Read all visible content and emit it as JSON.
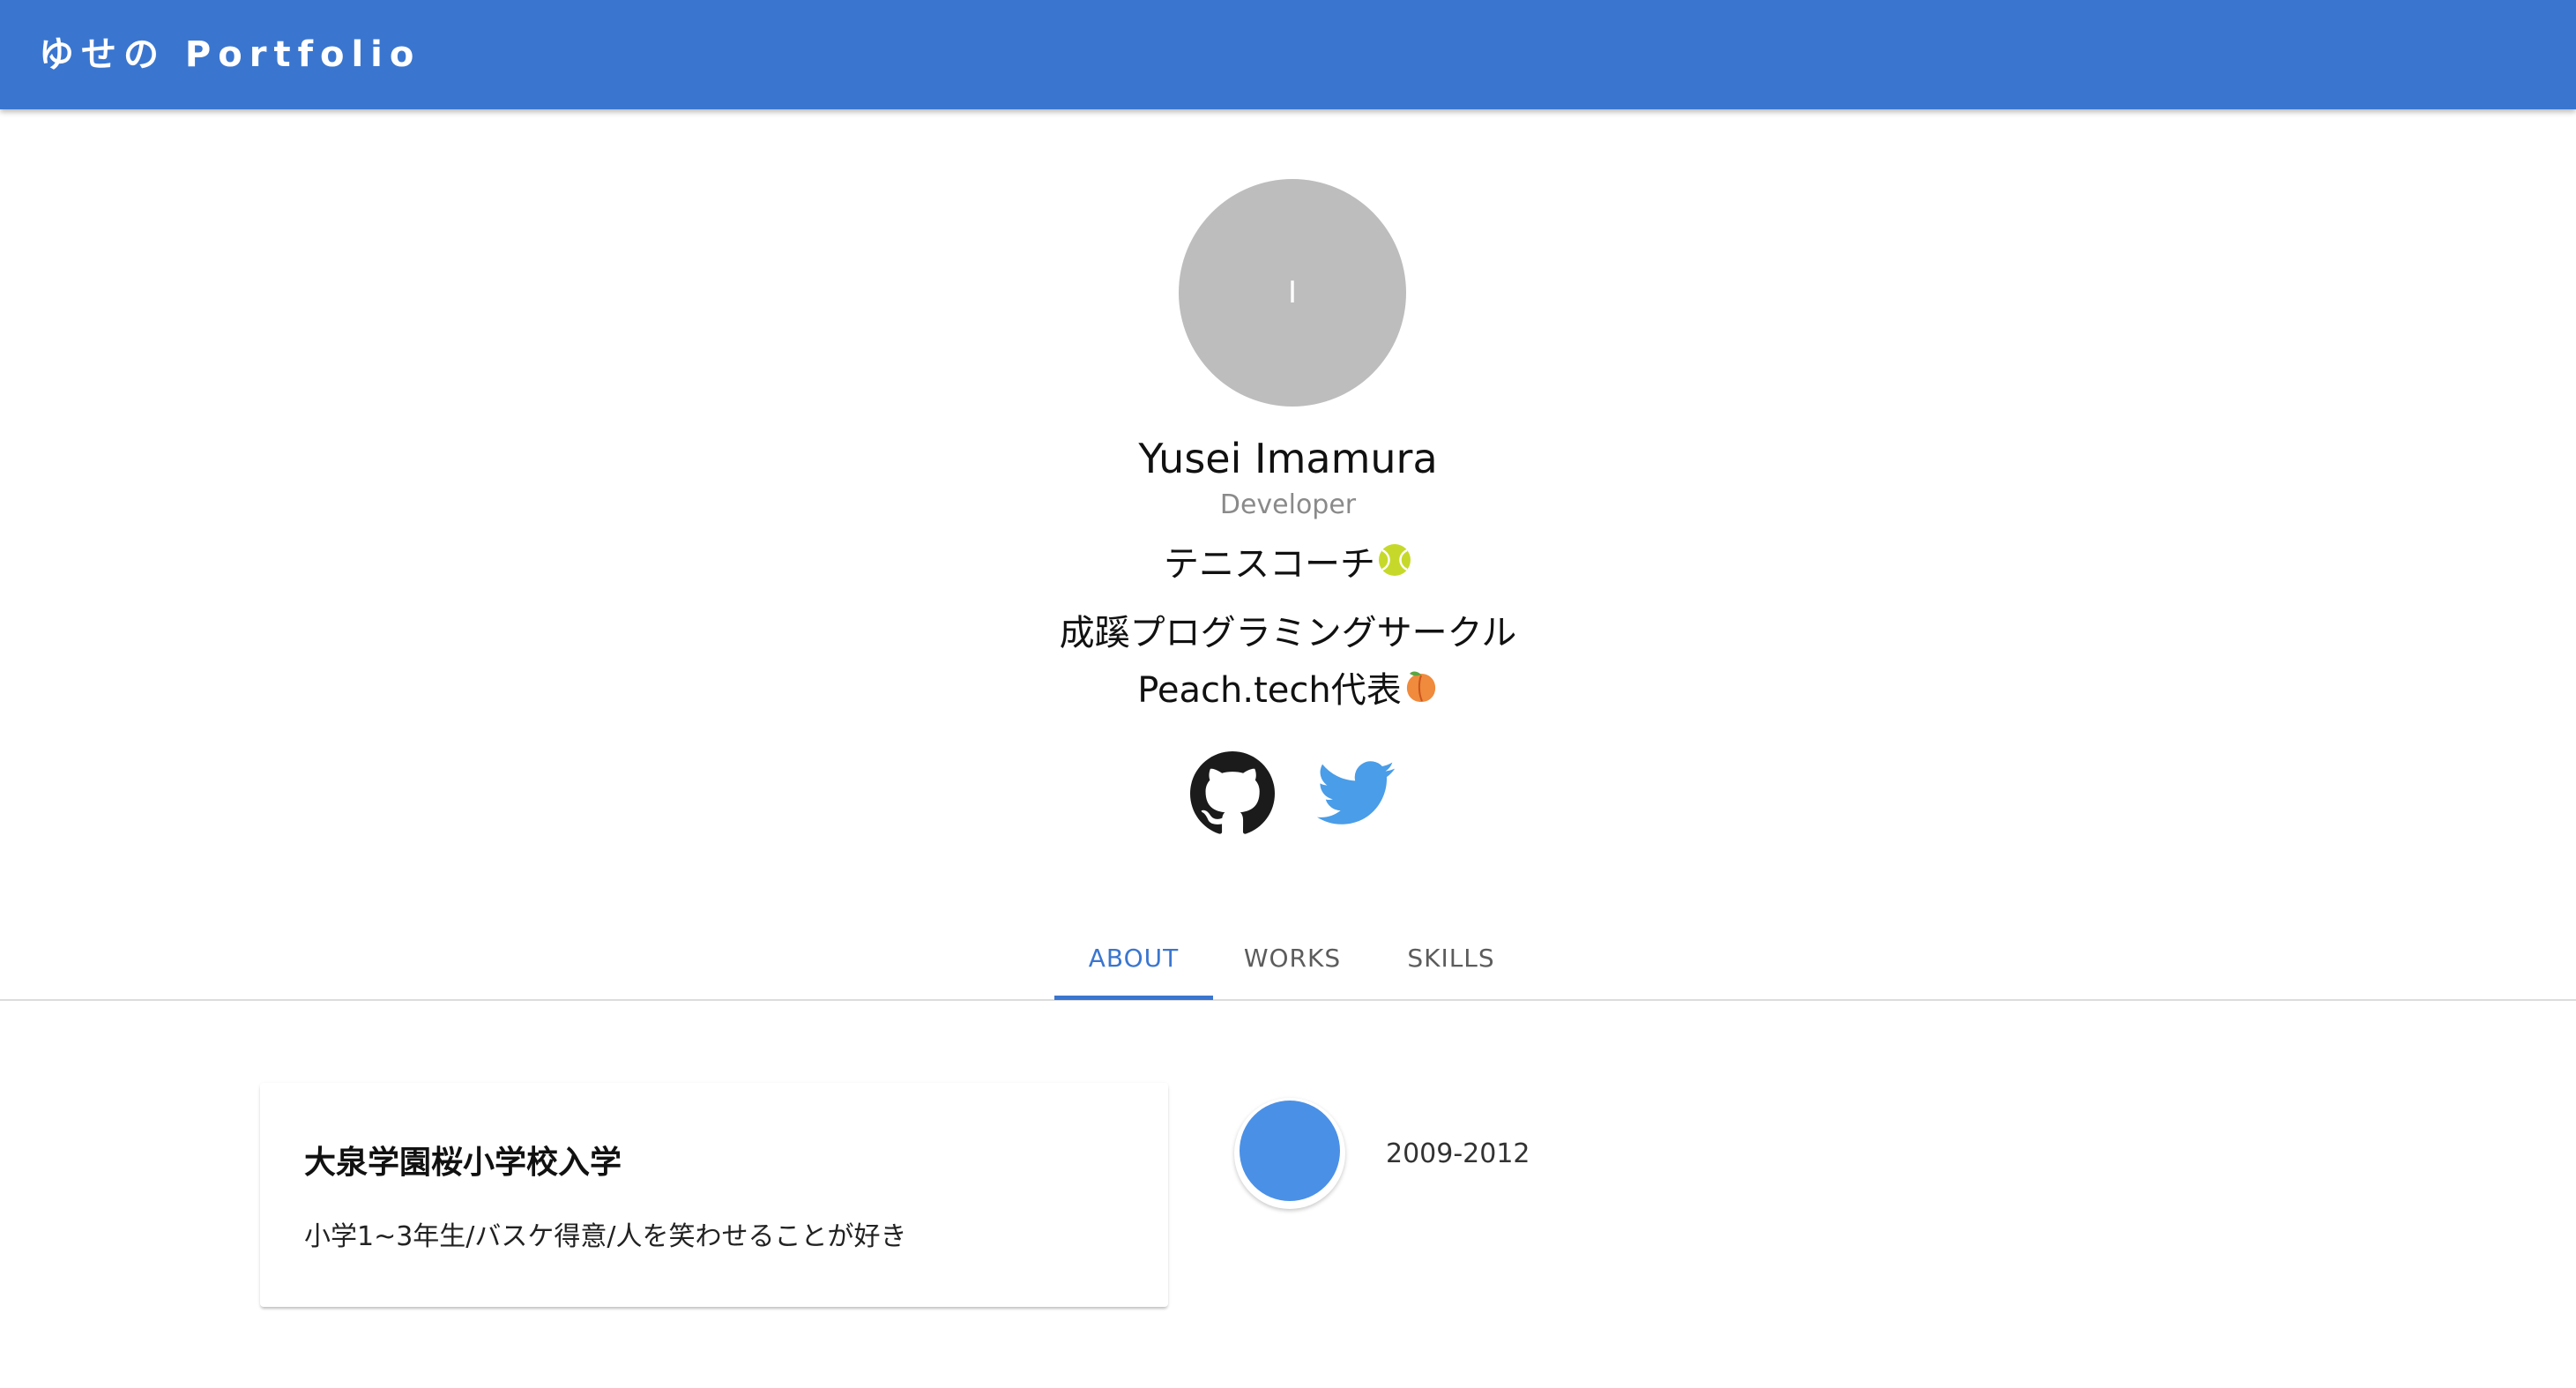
{
  "header": {
    "title": "ゆせの Portfolio"
  },
  "profile": {
    "avatar_initial": "I",
    "name": "Yusei Imamura",
    "role": "Developer",
    "bio_line1": "テニスコーチ",
    "bio_line2": "成蹊プログラミングサークル",
    "bio_line3": "Peach.tech代表",
    "bio_line1_emoji": "tennis-ball-icon",
    "bio_line3_emoji": "peach-icon"
  },
  "social": {
    "github_icon": "github-icon",
    "twitter_icon": "twitter-icon"
  },
  "tabs": [
    {
      "label": "ABOUT",
      "active": true
    },
    {
      "label": "WORKS",
      "active": false
    },
    {
      "label": "SKILLS",
      "active": false
    }
  ],
  "timeline": [
    {
      "title": "大泉学園桜小学校入学",
      "text": "小学1~3年生/バスケ得意/人を笑わせることが好き",
      "date": "2009-2012"
    }
  ],
  "colors": {
    "primary": "#3a76cf",
    "timeline_dot": "#4a90e6",
    "avatar_bg": "#bdbdbd",
    "twitter_blue": "#4a9de8",
    "github_dark": "#1b1b1b"
  }
}
